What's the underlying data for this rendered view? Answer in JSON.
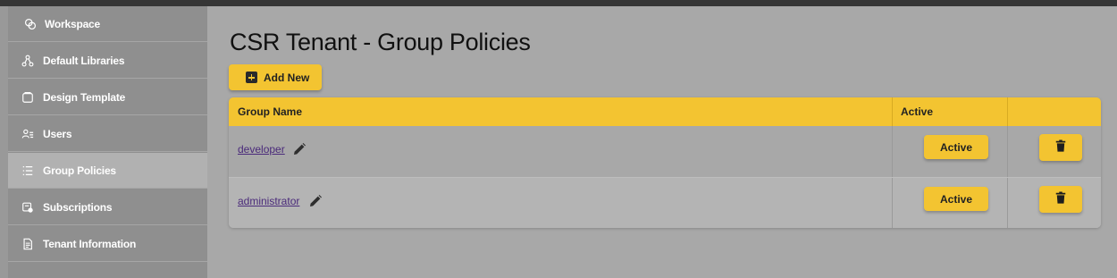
{
  "sidebar": {
    "items": [
      {
        "label": "Workspace",
        "icon": "workspace-icon",
        "active": false
      },
      {
        "label": "Default Libraries",
        "icon": "hierarchy-icon",
        "active": false
      },
      {
        "label": "Design Template",
        "icon": "template-icon",
        "active": false
      },
      {
        "label": "Users",
        "icon": "users-icon",
        "active": false
      },
      {
        "label": "Group Policies",
        "icon": "list-icon",
        "active": true
      },
      {
        "label": "Subscriptions",
        "icon": "subscriptions-icon",
        "active": false
      },
      {
        "label": "Tenant Information",
        "icon": "document-icon",
        "active": false
      }
    ]
  },
  "main": {
    "title": "CSR Tenant - Group Policies",
    "add_button_label": "Add New",
    "table": {
      "columns": [
        "Group Name",
        "Active",
        ""
      ],
      "rows": [
        {
          "group_name": "developer",
          "active_label": "Active"
        },
        {
          "group_name": "administrator",
          "active_label": "Active"
        }
      ]
    }
  },
  "colors": {
    "accent": "#f3c431",
    "sidebar": "#8f8f8f",
    "sidebar_active": "#b1b1b1",
    "background": "#a8a8a8",
    "link": "#4a2a7a"
  }
}
